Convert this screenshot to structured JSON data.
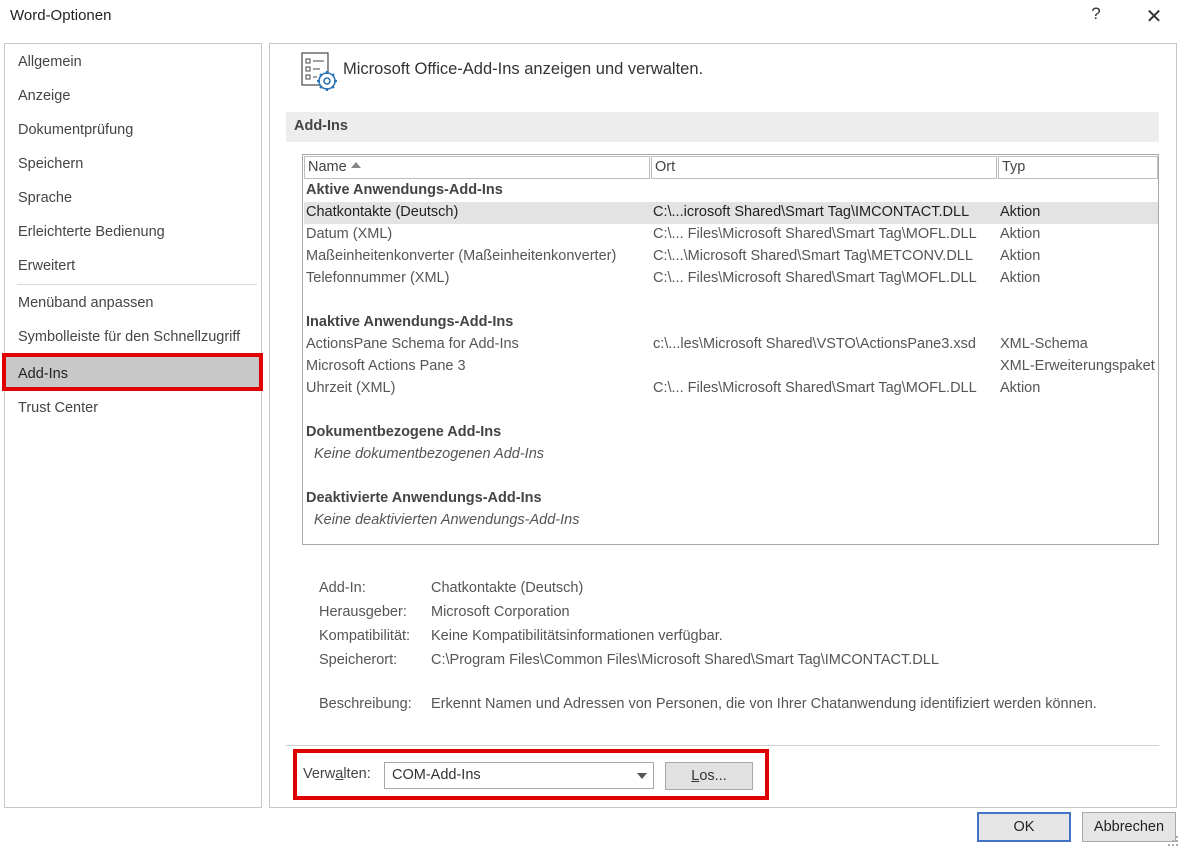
{
  "window": {
    "title": "Word-Optionen",
    "help": "?",
    "close": "✕"
  },
  "sidebar": {
    "items": [
      {
        "label": "Allgemein"
      },
      {
        "label": "Anzeige"
      },
      {
        "label": "Dokumentprüfung"
      },
      {
        "label": "Speichern"
      },
      {
        "label": "Sprache"
      },
      {
        "label": "Erleichterte Bedienung"
      },
      {
        "label": "Erweitert"
      },
      {
        "label": "Menüband anpassen"
      },
      {
        "label": "Symbolleiste für den Schnellzugriff"
      },
      {
        "label": "Add-Ins"
      },
      {
        "label": "Trust Center"
      }
    ],
    "selected": "Add-Ins"
  },
  "header": {
    "text": "Microsoft Office-Add-Ins anzeigen und verwalten."
  },
  "section": {
    "title": "Add-Ins"
  },
  "table": {
    "columns": {
      "name": "Name",
      "location": "Ort",
      "type": "Typ"
    },
    "sort": "Name ascending",
    "groups": {
      "active": {
        "title": "Aktive Anwendungs-Add-Ins",
        "rows": [
          {
            "name": "Chatkontakte (Deutsch)",
            "location": "C:\\...icrosoft Shared\\Smart Tag\\IMCONTACT.DLL",
            "type": "Aktion"
          },
          {
            "name": "Datum (XML)",
            "location": "C:\\... Files\\Microsoft Shared\\Smart Tag\\MOFL.DLL",
            "type": "Aktion"
          },
          {
            "name": "Maßeinheitenkonverter (Maßeinheitenkonverter)",
            "location": "C:\\...\\Microsoft Shared\\Smart Tag\\METCONV.DLL",
            "type": "Aktion"
          },
          {
            "name": "Telefonnummer (XML)",
            "location": "C:\\... Files\\Microsoft Shared\\Smart Tag\\MOFL.DLL",
            "type": "Aktion"
          }
        ]
      },
      "inactive": {
        "title": "Inaktive Anwendungs-Add-Ins",
        "rows": [
          {
            "name": "ActionsPane Schema for Add-Ins",
            "location": "c:\\...les\\Microsoft Shared\\VSTO\\ActionsPane3.xsd",
            "type": "XML-Schema"
          },
          {
            "name": "Microsoft Actions Pane 3",
            "location": "",
            "type": "XML-Erweiterungspaket"
          },
          {
            "name": "Uhrzeit (XML)",
            "location": "C:\\... Files\\Microsoft Shared\\Smart Tag\\MOFL.DLL",
            "type": "Aktion"
          }
        ]
      },
      "document": {
        "title": "Dokumentbezogene Add-Ins",
        "empty": "Keine dokumentbezogenen Add-Ins"
      },
      "disabled": {
        "title": "Deaktivierte Anwendungs-Add-Ins",
        "empty": "Keine deaktivierten Anwendungs-Add-Ins"
      }
    }
  },
  "details": {
    "addin": {
      "label": "Add-In:",
      "value": "Chatkontakte (Deutsch)"
    },
    "publisher": {
      "label": "Herausgeber:",
      "value": "Microsoft Corporation"
    },
    "compat": {
      "label": "Kompatibilität:",
      "value": "Keine Kompatibilitätsinformationen verfügbar."
    },
    "location": {
      "label": "Speicherort:",
      "value": "C:\\Program Files\\Common Files\\Microsoft Shared\\Smart Tag\\IMCONTACT.DLL"
    },
    "description": {
      "label": "Beschreibung:",
      "value": "Erkennt Namen und Adressen von Personen, die von Ihrer Chatanwendung identifiziert werden können."
    }
  },
  "manage": {
    "label_pre": "Verw",
    "label_accel": "a",
    "label_post": "lten:",
    "selected": "COM-Add-Ins",
    "go_accel": "L",
    "go_rest": "os..."
  },
  "buttons": {
    "ok": "OK",
    "cancel": "Abbrechen"
  },
  "colors": {
    "highlight_border": "#e00000",
    "selected_sidebar": "#c8c8c8",
    "selected_row": "#e3e3e3"
  }
}
